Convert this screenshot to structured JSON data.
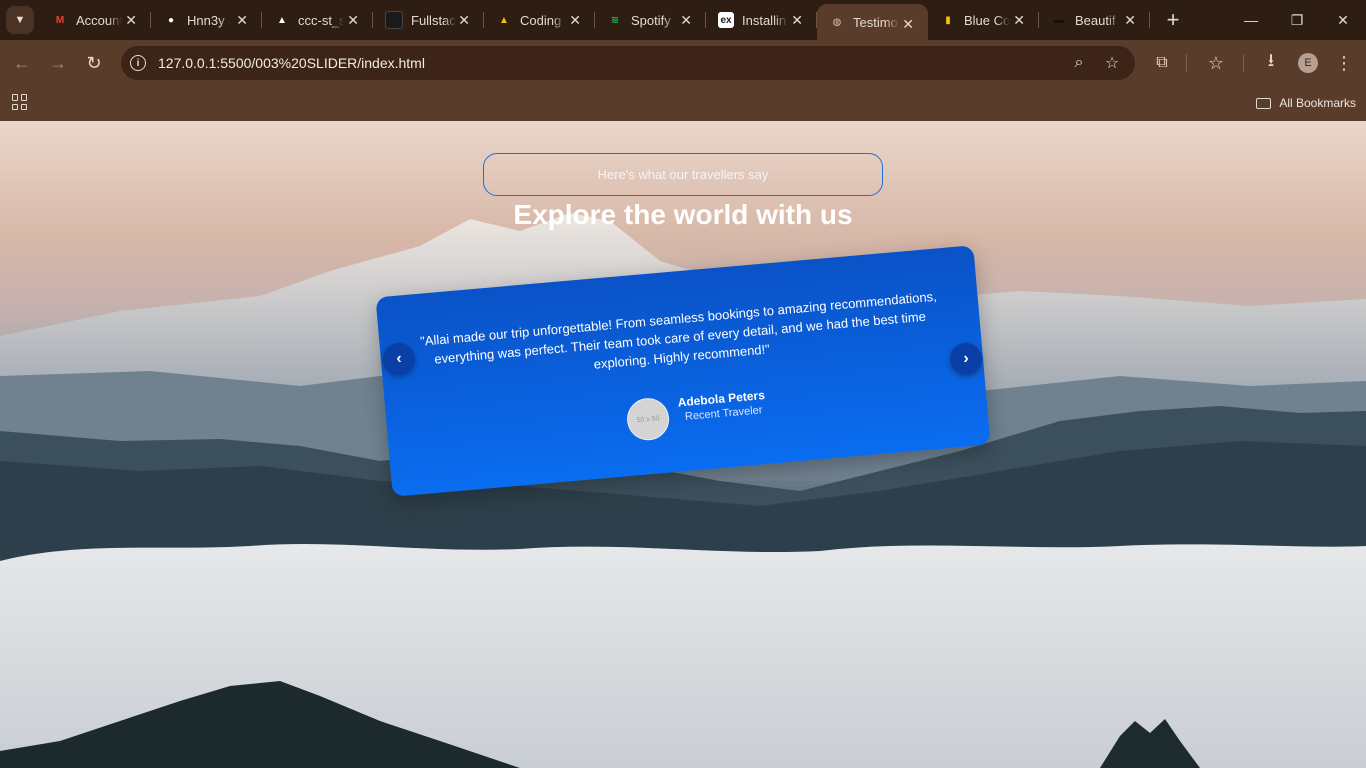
{
  "tabs": [
    {
      "title": "Account",
      "icon": "gmail-icon",
      "color": "#ea4335",
      "glyph": "M",
      "active": false
    },
    {
      "title": "Hnn3y",
      "icon": "github-icon",
      "color": "#ffffff",
      "glyph": "●",
      "active": false
    },
    {
      "title": "ccc-st_s",
      "icon": "vercel-icon",
      "color": "#ffffff",
      "glyph": "▲",
      "active": false
    },
    {
      "title": "Fullstac",
      "icon": "dark-square-icon",
      "color": "#1a1a1a",
      "glyph": "",
      "active": false
    },
    {
      "title": "Coding",
      "icon": "google-drive-icon",
      "color": "#fbbc04",
      "glyph": "▲",
      "active": false
    },
    {
      "title": "Spotify",
      "icon": "spotify-icon",
      "color": "#1db954",
      "glyph": "≋",
      "active": false
    },
    {
      "title": "Installin",
      "icon": "ex-icon",
      "color": "#ffffff",
      "glyph": "ex",
      "active": false
    },
    {
      "title": "Testimo",
      "icon": "globe-icon",
      "color": "#cfc2b8",
      "glyph": "◍",
      "active": true
    },
    {
      "title": "Blue Co",
      "icon": "colors-icon",
      "color": "#f4c20d",
      "glyph": "▮",
      "active": false
    },
    {
      "title": "Beautif",
      "icon": "template-icon",
      "color": "#111111",
      "glyph": "▬",
      "active": false
    }
  ],
  "window_controls": {
    "minimize": "—",
    "maximize": "❐",
    "close": "✕"
  },
  "toolbar": {
    "url": "127.0.0.1:5500/003%20SLIDER/index.html",
    "back": "←",
    "forward": "→",
    "reload": "↻",
    "zoom": "⌕",
    "star": "☆",
    "extensions": "⧉",
    "reading": "☆",
    "download": "⭳",
    "profile_initial": "E",
    "menu": "⋮"
  },
  "bookmarks": {
    "all_label": "All Bookmarks"
  },
  "page": {
    "pill_text": "Here's what our travellers say",
    "headline": "Explore the world with us",
    "testimonial": {
      "quote": "\"Allai made our trip unforgettable! From seamless bookings to amazing recommendations, everything was perfect. Their team took care of every detail, and we had the best time exploring. Highly recommend!\"",
      "photo_placeholder": "50 x 50",
      "author": "Adebola Peters",
      "role": "Recent Traveler"
    },
    "prev": "‹",
    "next": "›"
  },
  "colors": {
    "frame": "#2e1d12",
    "toolbar": "#5a3c2a",
    "card": "#0a6df0",
    "nav_button": "#0a3fa8"
  }
}
